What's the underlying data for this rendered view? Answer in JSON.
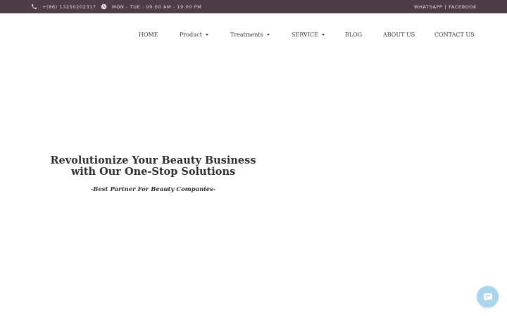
{
  "topbar": {
    "phone": "+(86) 13250202317",
    "hours": "MON - TUE : 09:00 AM - 19:00 PM",
    "whatsapp": "WHATSAPP",
    "separator": "|",
    "facebook": "FACEBOOK",
    "bg_color": "#4e3d46"
  },
  "nav": {
    "items": [
      {
        "label": "HOME"
      },
      {
        "label": "Product"
      },
      {
        "label": "Treatments"
      },
      {
        "label": "SERVICE"
      },
      {
        "label": "BLOG"
      },
      {
        "label": "ABOUT US"
      },
      {
        "label": "CONTACT US"
      }
    ]
  },
  "hero": {
    "title_line1": "Revolutionize Your Beauty Business",
    "title_line2": "with Our One-Stop Solutions",
    "subtitle": "-Best Partner For Beauty Companies-"
  },
  "chat": {
    "icon": "chat-bubble-icon",
    "color": "#a9d6ec"
  }
}
